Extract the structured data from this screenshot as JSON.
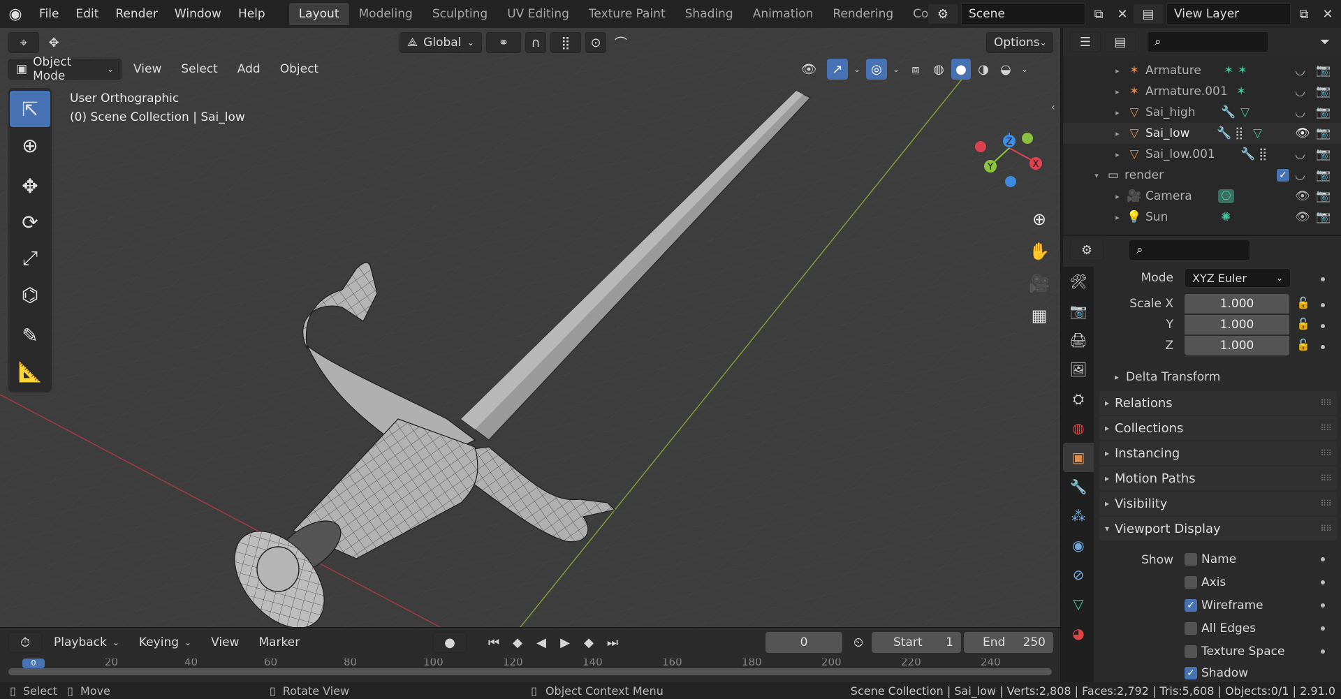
{
  "topbar": {
    "menus": [
      "File",
      "Edit",
      "Render",
      "Window",
      "Help"
    ],
    "workspaces": [
      "Layout",
      "Modeling",
      "Sculpting",
      "UV Editing",
      "Texture Paint",
      "Shading",
      "Animation",
      "Rendering",
      "Compos"
    ],
    "active_workspace": "Layout",
    "scene": "Scene",
    "view_layer": "View Layer"
  },
  "viewport": {
    "transform_orientation": "Global",
    "options_label": "Options",
    "mode": "Object Mode",
    "menus": [
      "View",
      "Select",
      "Add",
      "Object"
    ],
    "overlay_line1": "User Orthographic",
    "overlay_line2": "(0) Scene Collection | Sai_low",
    "gizmo_axes": {
      "x": "X",
      "y": "Y",
      "z": "Z"
    }
  },
  "timeline": {
    "menus": [
      "Playback",
      "Keying",
      "View",
      "Marker"
    ],
    "current_frame": "0",
    "start_label": "Start",
    "start_value": "1",
    "end_label": "End",
    "end_value": "250",
    "ruler": [
      "0",
      "20",
      "40",
      "60",
      "80",
      "100",
      "120",
      "140",
      "160",
      "180",
      "200",
      "220",
      "240"
    ]
  },
  "statusbar": {
    "select": "Select",
    "move": "Move",
    "rotate": "Rotate View",
    "context": "Object Context Menu",
    "stats": "Scene Collection | Sai_low | Verts:2,808 | Faces:2,792 | Tris:5,608 | Objects:0/1 | 2.91.0"
  },
  "outliner": {
    "items": [
      {
        "name": "Armature"
      },
      {
        "name": "Armature.001"
      },
      {
        "name": "Sai_high"
      },
      {
        "name": "Sai_low"
      },
      {
        "name": "Sai_low.001"
      },
      {
        "name": "render"
      },
      {
        "name": "Camera"
      },
      {
        "name": "Sun"
      }
    ]
  },
  "properties": {
    "mode_label": "Mode",
    "mode_value": "XYZ Euler",
    "scale_x_label": "Scale X",
    "scale_y_label": "Y",
    "scale_z_label": "Z",
    "scale_x": "1.000",
    "scale_y": "1.000",
    "scale_z": "1.000",
    "delta_transform": "Delta Transform",
    "panels": [
      "Relations",
      "Collections",
      "Instancing",
      "Motion Paths",
      "Visibility",
      "Viewport Display"
    ],
    "show_label": "Show",
    "show_options": [
      {
        "label": "Name",
        "checked": false
      },
      {
        "label": "Axis",
        "checked": false
      },
      {
        "label": "Wireframe",
        "checked": true
      },
      {
        "label": "All Edges",
        "checked": false
      },
      {
        "label": "Texture Space",
        "checked": false
      },
      {
        "label": "Shadow",
        "checked": true
      }
    ]
  },
  "colors": {
    "accent": "#4772b3",
    "x_axis": "#e0424f",
    "y_axis": "#8cc63f",
    "z_axis": "#3d8ee8"
  }
}
